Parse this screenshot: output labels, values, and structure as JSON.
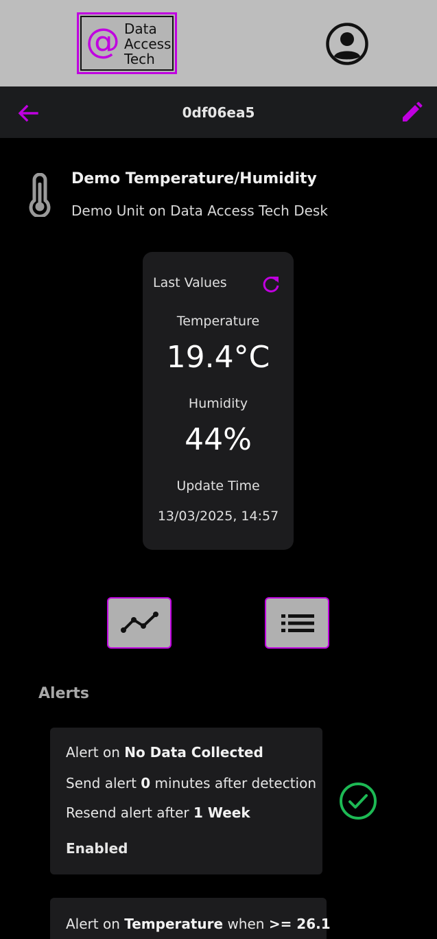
{
  "brand": {
    "logo_symbol": "@",
    "logo_lines": [
      "Data",
      "Access",
      "Tech"
    ],
    "accent_color": "#c000e0"
  },
  "header": {
    "avatar_icon": "account-circle-icon"
  },
  "navbar": {
    "title": "0df06ea5",
    "back_icon": "arrow-left-icon",
    "edit_icon": "pencil-icon"
  },
  "device": {
    "icon": "thermometer-icon",
    "name": "Demo Temperature/Humidity",
    "description": "Demo Unit on Data Access Tech Desk"
  },
  "last_values": {
    "heading": "Last Values",
    "refresh_icon": "refresh-icon",
    "temperature_label": "Temperature",
    "temperature_value": "19.4°C",
    "humidity_label": "Humidity",
    "humidity_value": "44%",
    "update_label": "Update Time",
    "update_value": "13/03/2025, 14:57"
  },
  "actions": {
    "chart_icon": "line-chart-icon",
    "list_icon": "list-icon"
  },
  "alerts": {
    "heading": "Alerts",
    "items": [
      {
        "line1_prefix": "Alert on ",
        "line1_bold": "No Data Collected",
        "line2_prefix": "Send alert ",
        "line2_bold": "0",
        "line2_suffix": " minutes after detection",
        "line3_prefix": "Resend alert after ",
        "line3_bold": "1 Week",
        "status": "Enabled",
        "status_icon": "check-circle-icon",
        "status_color": "#1db954"
      },
      {
        "line1_prefix": "Alert on ",
        "line1_bold": "Temperature",
        "line1_mid": " when ",
        "line1_bold2": ">= 26.1"
      }
    ]
  }
}
